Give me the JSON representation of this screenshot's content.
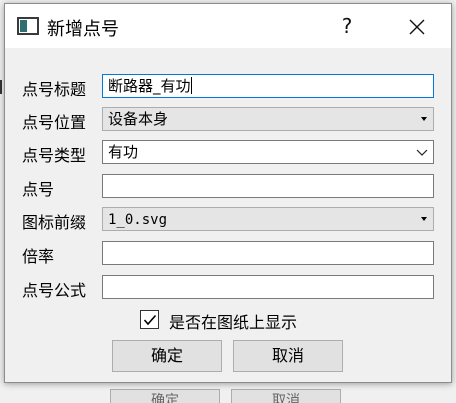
{
  "dialog": {
    "title": "新增点号",
    "help_label": "?",
    "icons": {
      "app": "window-icon",
      "close": "close-icon"
    }
  },
  "form": {
    "title_label": "点号标题",
    "title_value": "断路器_有功",
    "position_label": "点号位置",
    "position_value": "设备本身",
    "type_label": "点号类型",
    "type_value": "有功",
    "point_label": "点号",
    "point_value": "",
    "icon_prefix_label": "图标前缀",
    "icon_prefix_value": "1_0.svg",
    "ratio_label": "倍率",
    "ratio_value": "",
    "formula_label": "点号公式",
    "formula_value": ""
  },
  "display_option": {
    "label": "是否在图纸上显示",
    "checked": true
  },
  "buttons": {
    "ok": "确定",
    "cancel": "取消"
  },
  "colors": {
    "focus_border": "#0078d7",
    "button_bg": "#e1e1e1"
  }
}
